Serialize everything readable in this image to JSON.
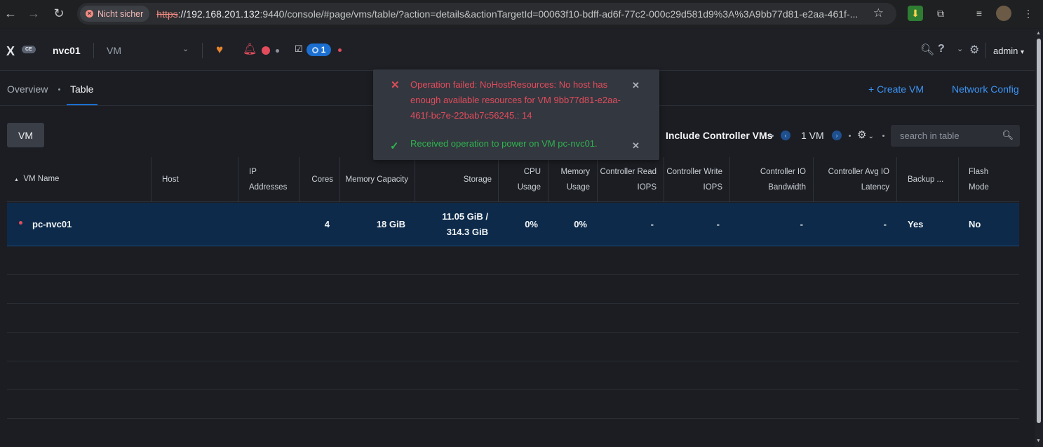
{
  "browser": {
    "security_chip": "Nicht sicher",
    "url_scheme": "https",
    "url_host": "://192.168.201.132",
    "url_rest": ":9440/console/#page/vms/table/?action=details&actionTargetId=00063f10-bdff-ad6f-77c2-000c29d581d9%3A%3A9bb77d81-e2aa-461f-..."
  },
  "header": {
    "logo_text": "X",
    "logo_badge": "CE",
    "cluster_name": "nvc01",
    "entity_selector": "VM",
    "task_count": "1",
    "user": "admin"
  },
  "subnav": {
    "tabs": [
      "Overview",
      "Table"
    ],
    "create_vm": "+ Create VM",
    "network_config": "Network Config"
  },
  "toolbar": {
    "vm_button": "VM",
    "include_controller": "Include Controller VMs",
    "vm_count": "1 VM",
    "search_placeholder": "search in table"
  },
  "table": {
    "columns": [
      {
        "l1": "VM Name",
        "l2": ""
      },
      {
        "l1": "Host",
        "l2": ""
      },
      {
        "l1": "IP",
        "l2": "Addresses"
      },
      {
        "l1": "Cores",
        "l2": ""
      },
      {
        "l1": "Memory Capacity",
        "l2": ""
      },
      {
        "l1": "Storage",
        "l2": ""
      },
      {
        "l1": "CPU",
        "l2": "Usage"
      },
      {
        "l1": "Memory",
        "l2": "Usage"
      },
      {
        "l1": "Controller Read",
        "l2": "IOPS"
      },
      {
        "l1": "Controller Write",
        "l2": "IOPS"
      },
      {
        "l1": "Controller IO",
        "l2": "Bandwidth"
      },
      {
        "l1": "Controller Avg IO",
        "l2": "Latency"
      },
      {
        "l1": "Backup ...",
        "l2": ""
      },
      {
        "l1": "Flash",
        "l2": "Mode"
      }
    ],
    "rows": [
      {
        "name": "pc-nvc01",
        "host": "",
        "ip": "",
        "cores": "4",
        "memory": "18 GiB",
        "storage_l1": "11.05 GiB /",
        "storage_l2": "314.3 GiB",
        "cpu": "0%",
        "mem_usage": "0%",
        "ctrl_read": "-",
        "ctrl_write": "-",
        "ctrl_bw": "-",
        "ctrl_latency": "-",
        "backup": "Yes",
        "flash": "No"
      }
    ]
  },
  "notifications": [
    {
      "type": "error",
      "message": "Operation failed: NoHostResources: No host has enough available resources for VM 9bb77d81-e2aa-461f-bc7e-22bab7c56245.: 14"
    },
    {
      "type": "success",
      "message": "Received operation to power on VM pc-nvc01."
    }
  ],
  "colors": {
    "accent": "#1b6fd1",
    "error": "#e24c5c",
    "success": "#2fb34f",
    "warning": "#e6842c"
  }
}
